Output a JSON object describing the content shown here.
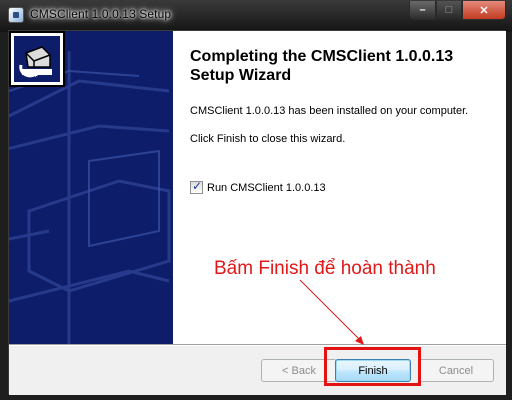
{
  "window": {
    "title": "CMSClient 1.0.0.13 Setup",
    "caption_buttons": {
      "minimize": "–",
      "maximize": "□",
      "close": "✕"
    }
  },
  "content": {
    "heading": "Completing the CMSClient 1.0.0.13 Setup Wizard",
    "installed_text": "CMSClient 1.0.0.13 has been installed on your computer.",
    "close_text": "Click Finish to close this wizard.",
    "run_checkbox": {
      "label": "Run CMSClient 1.0.0.13",
      "checked": true
    }
  },
  "annotation": {
    "text": "Bấm Finish để hoàn thành",
    "color": "#e01818"
  },
  "buttons": {
    "back": "< Back",
    "finish": "Finish",
    "cancel": "Cancel"
  },
  "colors": {
    "banner": "#0d1d6a",
    "highlight": "#e31313"
  },
  "icons": {
    "app": "installer-icon",
    "banner_logo": "install-box-icon"
  }
}
